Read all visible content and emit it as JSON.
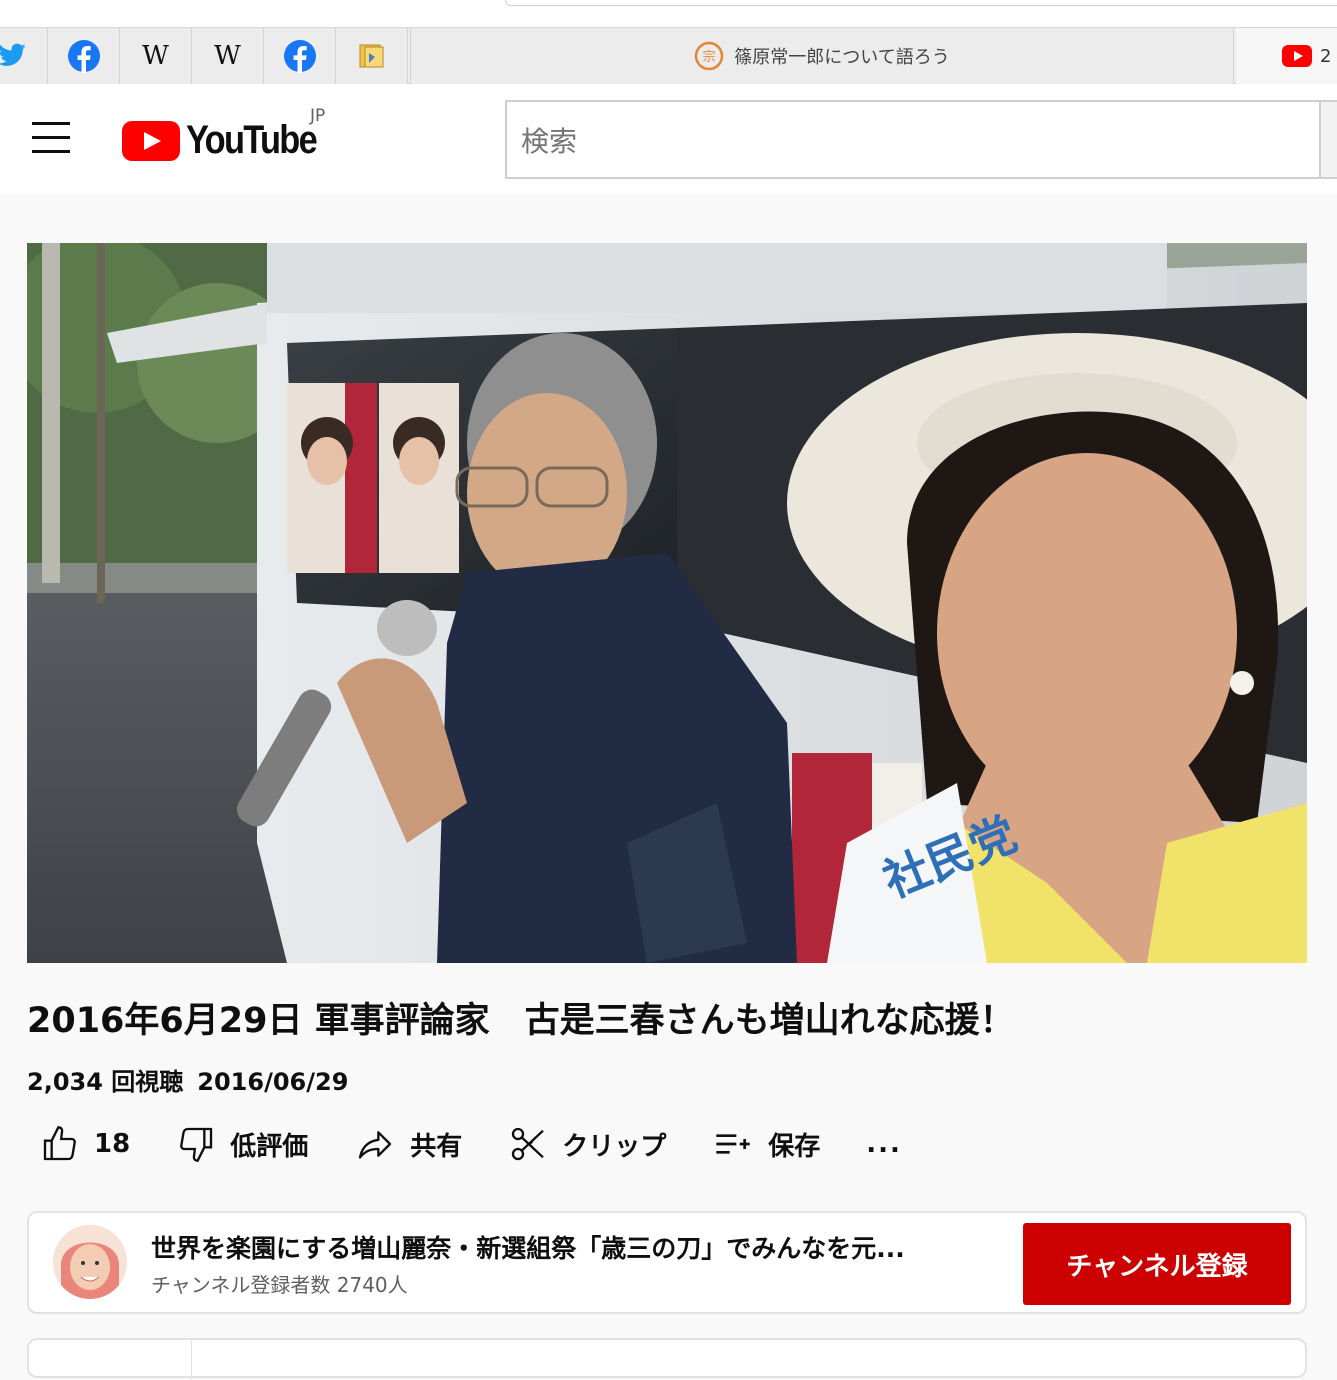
{
  "browser": {
    "bookmarks": [
      {
        "icon": "twitter-icon"
      },
      {
        "icon": "facebook-icon"
      },
      {
        "icon": "wikipedia-icon",
        "glyph": "W"
      },
      {
        "icon": "wikipedia-icon",
        "glyph": "W"
      },
      {
        "icon": "facebook-icon"
      },
      {
        "icon": "folder-icon"
      }
    ],
    "active_tab_title": "篠原常一郎について語ろう",
    "right_tab_number": "2"
  },
  "masthead": {
    "logo_text": "YouTube",
    "country": "JP",
    "search_placeholder": "検索"
  },
  "video": {
    "title": "2016年6月29日 軍事評論家　古是三春さんも増山れな応援！",
    "views": "2,034 回視聴",
    "date": "2016/06/29",
    "sash_text": "社民党"
  },
  "actions": {
    "like_count": "18",
    "dislike_label": "低評価",
    "share_label": "共有",
    "clip_label": "クリップ",
    "save_label": "保存",
    "more_label": "..."
  },
  "channel": {
    "name": "世界を楽園にする増山麗奈・新選組祭「歳三の刀」でみんなを元...",
    "subscribers": "チャンネル登録者数 2740人",
    "subscribe_label": "チャンネル登録"
  },
  "colors": {
    "brand_red": "#ff0000",
    "subscribe_red": "#cc0000",
    "facebook_blue": "#1877f2",
    "twitter_blue": "#1d9bf0"
  }
}
